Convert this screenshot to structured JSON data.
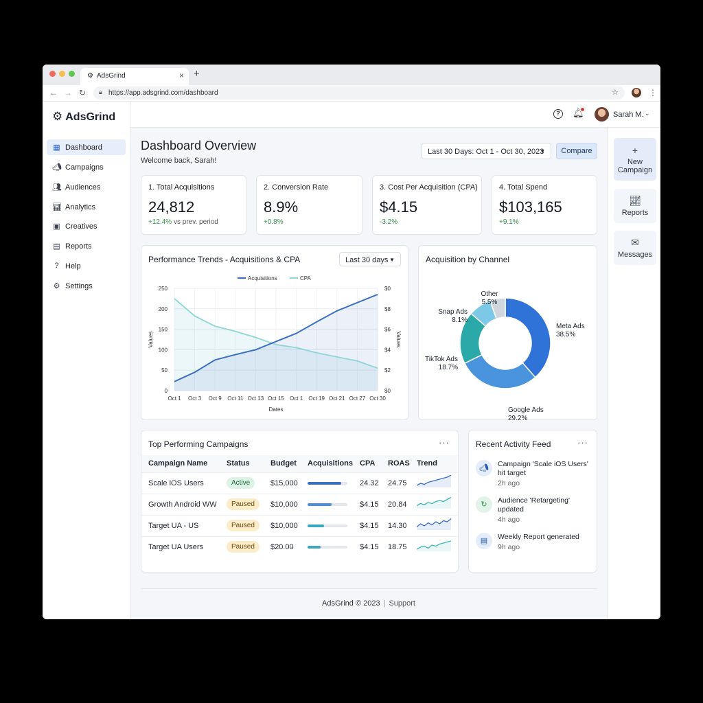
{
  "browser": {
    "tab_title": "AdsGrind",
    "url": "https://app.adsgrind.com/dashboard",
    "close_glyph": "×",
    "new_tab_glyph": "+"
  },
  "app": {
    "brand": "AdsGrind",
    "user_name": "Sarah M."
  },
  "sidebar": {
    "items": [
      {
        "label": "Dashboard",
        "icon": "dashboard-icon",
        "active": true
      },
      {
        "label": "Campaigns",
        "icon": "megaphone-icon"
      },
      {
        "label": "Audiences",
        "icon": "users-icon"
      },
      {
        "label": "Analytics",
        "icon": "bar-chart-icon"
      },
      {
        "label": "Creatives",
        "icon": "image-icon"
      },
      {
        "label": "Reports",
        "icon": "document-icon"
      },
      {
        "label": "Help",
        "icon": "help-icon"
      },
      {
        "label": "Settings",
        "icon": "gear-icon"
      }
    ]
  },
  "header": {
    "title": "Dashboard Overview",
    "welcome": "Welcome back, Sarah!",
    "date_range": "Last 30 Days: Oct 1 - Oct 30, 2023",
    "compare": "Compare"
  },
  "kpis": [
    {
      "label": "1. Total Acquisitions",
      "value": "24,812",
      "delta": "+12.4%",
      "delta_suffix": " vs prev. period"
    },
    {
      "label": "2. Conversion Rate",
      "value": "8.9%",
      "delta": "+0.8%",
      "delta_suffix": ""
    },
    {
      "label": "3. Cost Per Acquisition (CPA)",
      "value": "$4.15",
      "delta": "-3.2%",
      "delta_suffix": ""
    },
    {
      "label": "4. Total Spend",
      "value": "$103,165",
      "delta": "+9.1%",
      "delta_suffix": ""
    }
  ],
  "rail": {
    "new_campaign": "New Campaign",
    "reports": "Reports",
    "messages": "Messages"
  },
  "trends": {
    "title": "Performance Trends - Acquisitions & CPA",
    "select": "Last 30 days"
  },
  "channel": {
    "title": "Acquisition by Channel"
  },
  "campaigns": {
    "title": "Top Performing Campaigns",
    "columns": [
      "Campaign Name",
      "Status",
      "Budget",
      "Acquisitions",
      "CPA",
      "ROAS",
      "Trend"
    ],
    "rows": [
      {
        "name": "Scale iOS Users",
        "status": "Active",
        "budget": "$15,000",
        "acq_fraction": 0.85,
        "cpa": "24.32",
        "roas": "24.75"
      },
      {
        "name": "Growth Android WW",
        "status": "Paused",
        "budget": "$10,000",
        "acq_fraction": 0.6,
        "cpa": "$4.15",
        "roas": "20.84"
      },
      {
        "name": "Target UA - US",
        "status": "Paused",
        "budget": "$10,000",
        "acq_fraction": 0.42,
        "cpa": "$4.15",
        "roas": "14.30"
      },
      {
        "name": "Target UA Users",
        "status": "Paused",
        "budget": "$20.00",
        "acq_fraction": 0.32,
        "cpa": "$4.15",
        "roas": "18.75"
      }
    ]
  },
  "feed": {
    "title": "Recent Activity Feed",
    "items": [
      {
        "text": "Campaign 'Scale iOS Users' hit target",
        "time": "2h ago",
        "icon": "megaphone-icon"
      },
      {
        "text": "Audience 'Retargeting' updated",
        "time": "4h ago",
        "icon": "refresh-icon"
      },
      {
        "text": "Weekly Report generated",
        "time": "9h ago",
        "icon": "document-icon"
      }
    ]
  },
  "footer": {
    "copyright": "AdsGrind © 2023",
    "support": "Support"
  },
  "colors": {
    "acquisitions": "#3b6fc4",
    "cpa": "#8fd5d8",
    "accent": "#2a64c8",
    "positive": "#2e9444"
  },
  "chart_data": [
    {
      "type": "line",
      "title": "Performance Trends - Acquisitions & CPA",
      "x": [
        "Oct 1",
        "Oct 3",
        "Oct 9",
        "Oct 11",
        "Oct 13",
        "Oct 15",
        "Oct 1",
        "Oct 19",
        "Oct 21",
        "Oct 27",
        "Oct 30"
      ],
      "series": [
        {
          "name": "Acquisitions",
          "axis": "left",
          "values": [
            22,
            45,
            75,
            88,
            100,
            120,
            140,
            168,
            195,
            215,
            235
          ]
        },
        {
          "name": "CPA",
          "axis": "right",
          "values": [
            9.0,
            7.3,
            6.3,
            5.8,
            5.2,
            4.5,
            4.2,
            3.7,
            3.3,
            2.9,
            2.2
          ]
        }
      ],
      "xlabel": "Dates",
      "ylabel": "Values",
      "ylabel_right": "Values",
      "ylim": [
        0,
        250
      ],
      "ylim_right": [
        0,
        10
      ],
      "yticks": [
        "0",
        "50",
        "100",
        "150",
        "200",
        "250"
      ],
      "yticks_right": [
        "$0",
        "$2",
        "$4",
        "$6",
        "$8",
        "$0"
      ],
      "legend": "top-center",
      "grid": true
    },
    {
      "type": "pie",
      "title": "Acquisition by Channel",
      "categories": [
        "Meta Ads",
        "Google Ads",
        "TikTok Ads",
        "Snap Ads",
        "Other"
      ],
      "values": [
        38.5,
        29.2,
        18.7,
        8.1,
        5.5
      ],
      "labels": [
        "38.5%",
        "29.2%",
        "18.7%",
        "8.1%",
        "5.5%"
      ],
      "colors": [
        "#2f73d8",
        "#4a94dd",
        "#2aa9a8",
        "#7cc8e6",
        "#cfd6dd"
      ],
      "donut": true
    }
  ]
}
